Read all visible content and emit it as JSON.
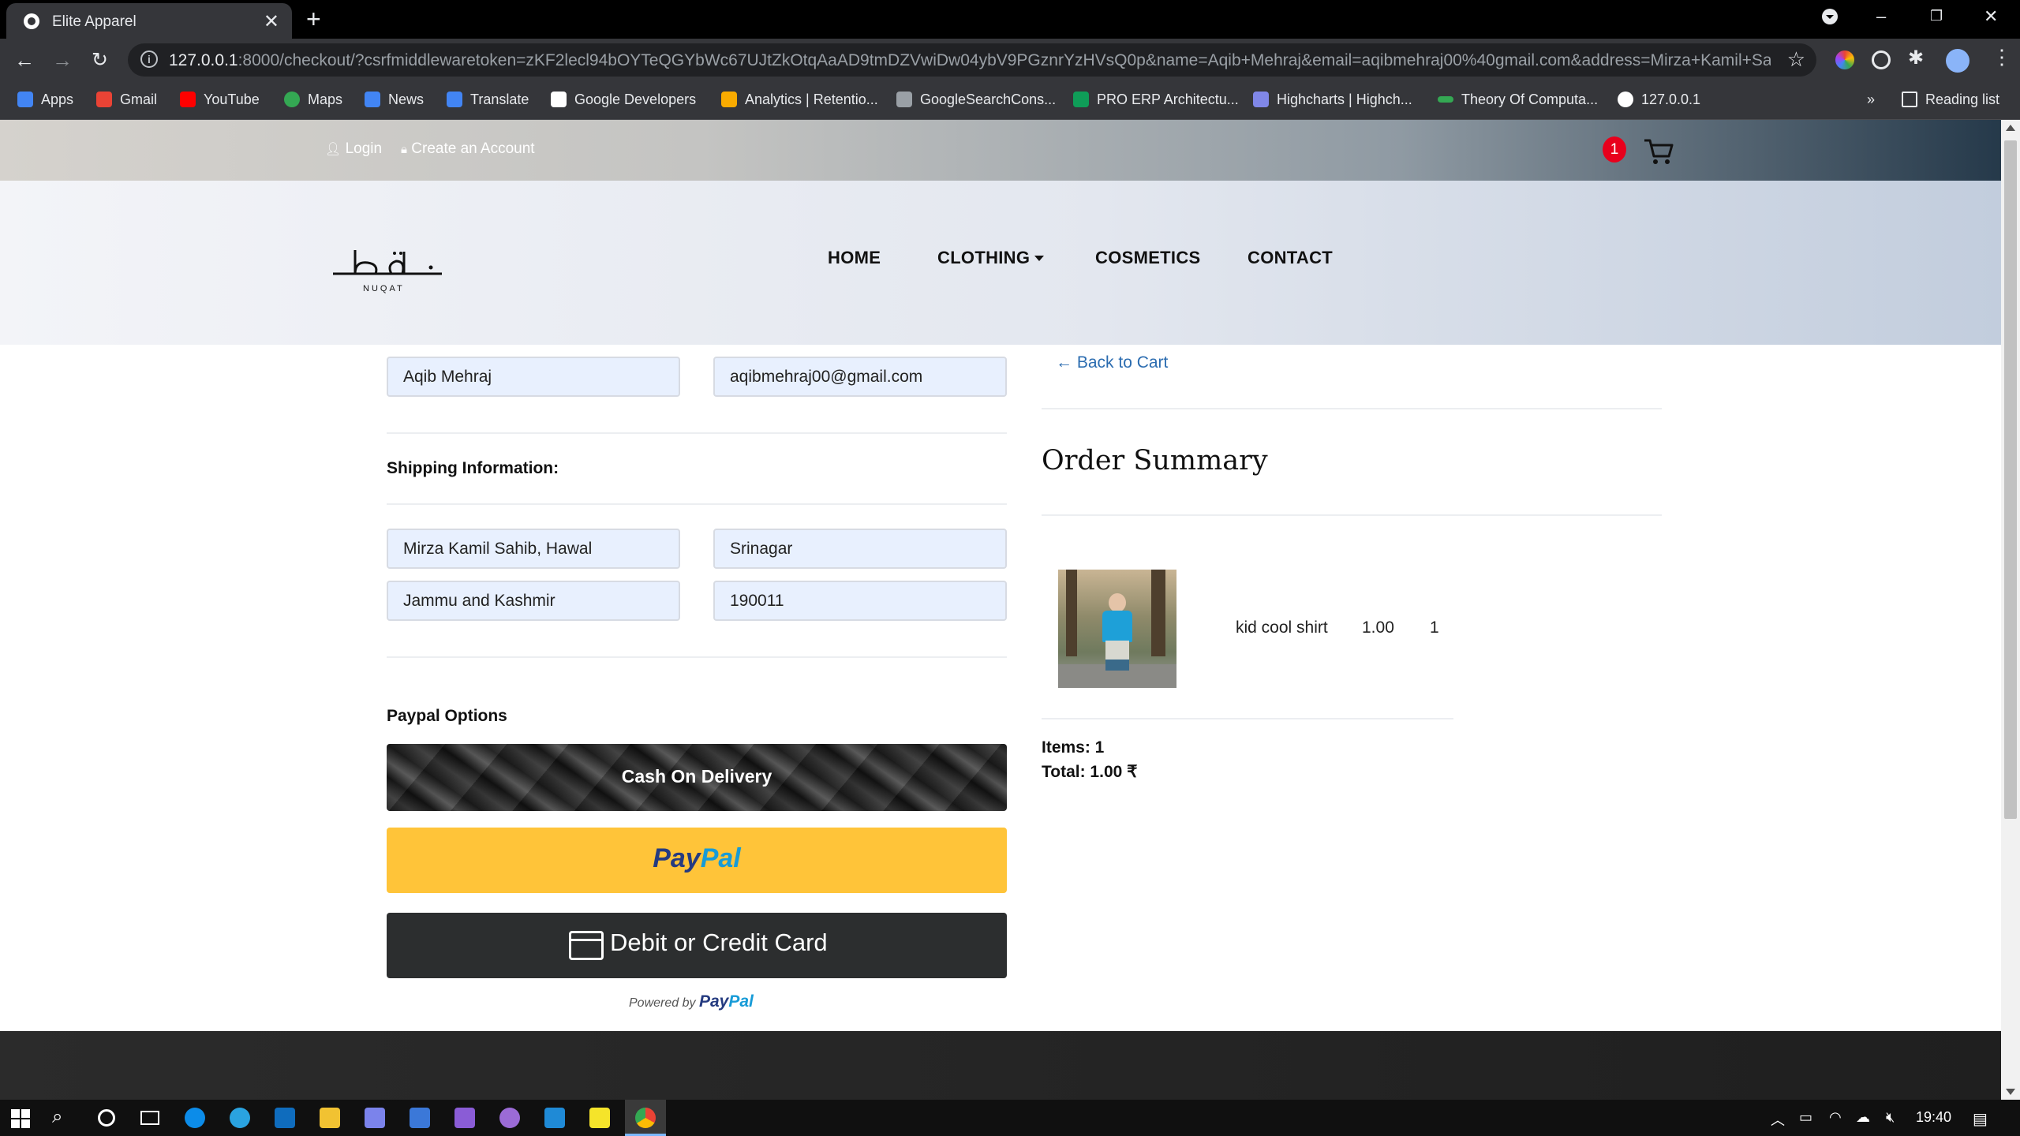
{
  "browser": {
    "tab_title": "Elite Apparel",
    "url_host": "127.0.0.1",
    "url_rest": ":8000/checkout/?csrfmiddlewaretoken=zKF2lecl94bOYTeQGYbWc67UJtZkOtqAaAD9tmDZVwiDw04ybV9PGznrYzHVsQ0p&name=Aqib+Mehraj&email=aqibmehraj00%40gmail.com&address=Mirza+Kamil+Sah...",
    "bookmarks": [
      {
        "label": "Apps",
        "color": "#4285f4"
      },
      {
        "label": "Gmail",
        "color": "#ea4335"
      },
      {
        "label": "YouTube",
        "color": "#ff0000"
      },
      {
        "label": "Maps",
        "color": "#34a853"
      },
      {
        "label": "News",
        "color": "#4285f4"
      },
      {
        "label": "Translate",
        "color": "#4285f4"
      },
      {
        "label": "Google Developers",
        "color": "#ffffff"
      },
      {
        "label": "Analytics | Retentio...",
        "color": "#f9ab00"
      },
      {
        "label": "GoogleSearchCons...",
        "color": "#9aa0a6"
      },
      {
        "label": "PRO ERP Architectu...",
        "color": "#0f9d58"
      },
      {
        "label": "Highcharts | Highch...",
        "color": "#8087e8"
      },
      {
        "label": "Theory Of Computa...",
        "color": "#34a853"
      },
      {
        "label": "127.0.0.1",
        "color": "#ffffff"
      }
    ],
    "reading_list": "Reading list",
    "overflow": "»"
  },
  "site": {
    "login": "Login",
    "create_account": "Create an Account",
    "cart_count": "1",
    "nav": {
      "home": "HOME",
      "clothing": "CLOTHING",
      "cosmetics": "COSMETICS",
      "contact": "CONTACT"
    },
    "logo_text": "NUQAT"
  },
  "form": {
    "name": "Aqib Mehraj",
    "email": "aqibmehraj00@gmail.com",
    "shipping_heading": "Shipping Information:",
    "address": "Mirza Kamil Sahib, Hawal",
    "city": "Srinagar",
    "state": "Jammu and Kashmir",
    "zipcode": "190011",
    "paypal_heading": "Paypal Options",
    "cod_label": "Cash On Delivery",
    "paypal_pay": "Pay",
    "paypal_pal": "Pal",
    "card_label": "Debit or Credit Card",
    "powered_by": "Powered by"
  },
  "summary": {
    "back_link": "← Back to Cart",
    "title": "Order Summary",
    "item_name": "kid cool shirt",
    "item_price": "1.00",
    "item_qty": "1",
    "items_total": "Items: 1",
    "total": "Total: 1.00 ₹"
  },
  "taskbar": {
    "time": "19:40"
  }
}
